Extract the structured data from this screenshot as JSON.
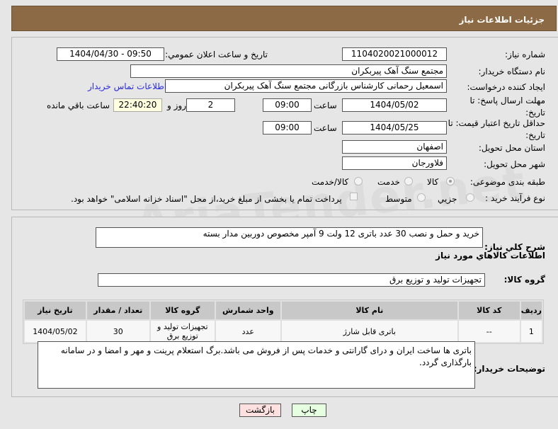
{
  "header": {
    "title": "جزئیات اطلاعات نیاز"
  },
  "form": {
    "need_number_label": "شماره نیاز:",
    "need_number": "1104020021000012",
    "announce_label": "تاریخ و ساعت اعلان عمومي:",
    "announce_value": "1404/04/30 - 09:50",
    "buyer_label": "نام دستگاه خريدار:",
    "buyer": "مجتمع سنگ آهک پیربکران",
    "creator_label": "ايجاد کننده درخواست:",
    "creator": "اسمعیل رحمانی کارشناس بازرگانی مجتمع سنگ آهک پیربکران",
    "contact_link": "اطلاعات تماس خريدار",
    "deadline_label": "مهلت ارسال پاسخ: تا تاريخ:",
    "deadline_date": "1404/05/02",
    "time_label": "ساعت",
    "deadline_time": "09:00",
    "days": "2",
    "days_label": "روز و",
    "remaining": "22:40:20",
    "remaining_label": "ساعت باقي مانده",
    "validity_label": "حداقل تاريخ اعتبار قيمت: تا تاريخ:",
    "validity_date": "1404/05/25",
    "validity_time": "09:00",
    "province_label": "استان محل تحويل:",
    "province": "اصفهان",
    "city_label": "شهر محل تحويل:",
    "city": "فلاورجان",
    "category_label": "طبقه بندی موضوعی:",
    "category_options": [
      "کالا",
      "خدمت",
      "کالا/خدمت"
    ],
    "category_selected": "کالا",
    "process_label": "نوع فرآيند خريد :",
    "process_options": [
      "جزيي",
      "متوسط"
    ],
    "payment_note": "پرداخت تمام يا بخشی از مبلغ خريد،از محل \"اسناد خزانه اسلامی\" خواهد بود."
  },
  "details": {
    "desc_label": "شرح کلي نياز:",
    "desc": "خرید و حمل و نصب 30 عدد باتری 12 ولت 9 آمپر مخصوص دوربین مدار بسته",
    "goods_title": "اطلاعات کالاهاي مورد نياز",
    "group_label": "گروه کالا:",
    "group": "تجهیزات تولید و توزیع برق",
    "table": {
      "headers": [
        "رديف",
        "کد کالا",
        "نام کالا",
        "واحد شمارش",
        "گروه کالا",
        "تعداد / مقدار",
        "تاريخ نياز"
      ],
      "rows": [
        [
          "1",
          "--",
          "باتری قابل شارژ",
          "عدد",
          "تجهیزات تولید و توزیع برق",
          "30",
          "1404/05/02"
        ]
      ]
    },
    "notes_label": "توضيحات خريدار:",
    "notes": "باتری ها ساخت ایران و درای گارانتی و خدمات پس از فروش می باشد.برگ استعلام پرینت و مهر و امضا و در سامانه بارگذاری گردد."
  },
  "buttons": {
    "back": "بازگشت",
    "print": "چاپ"
  },
  "watermark": "AriaTender.net"
}
